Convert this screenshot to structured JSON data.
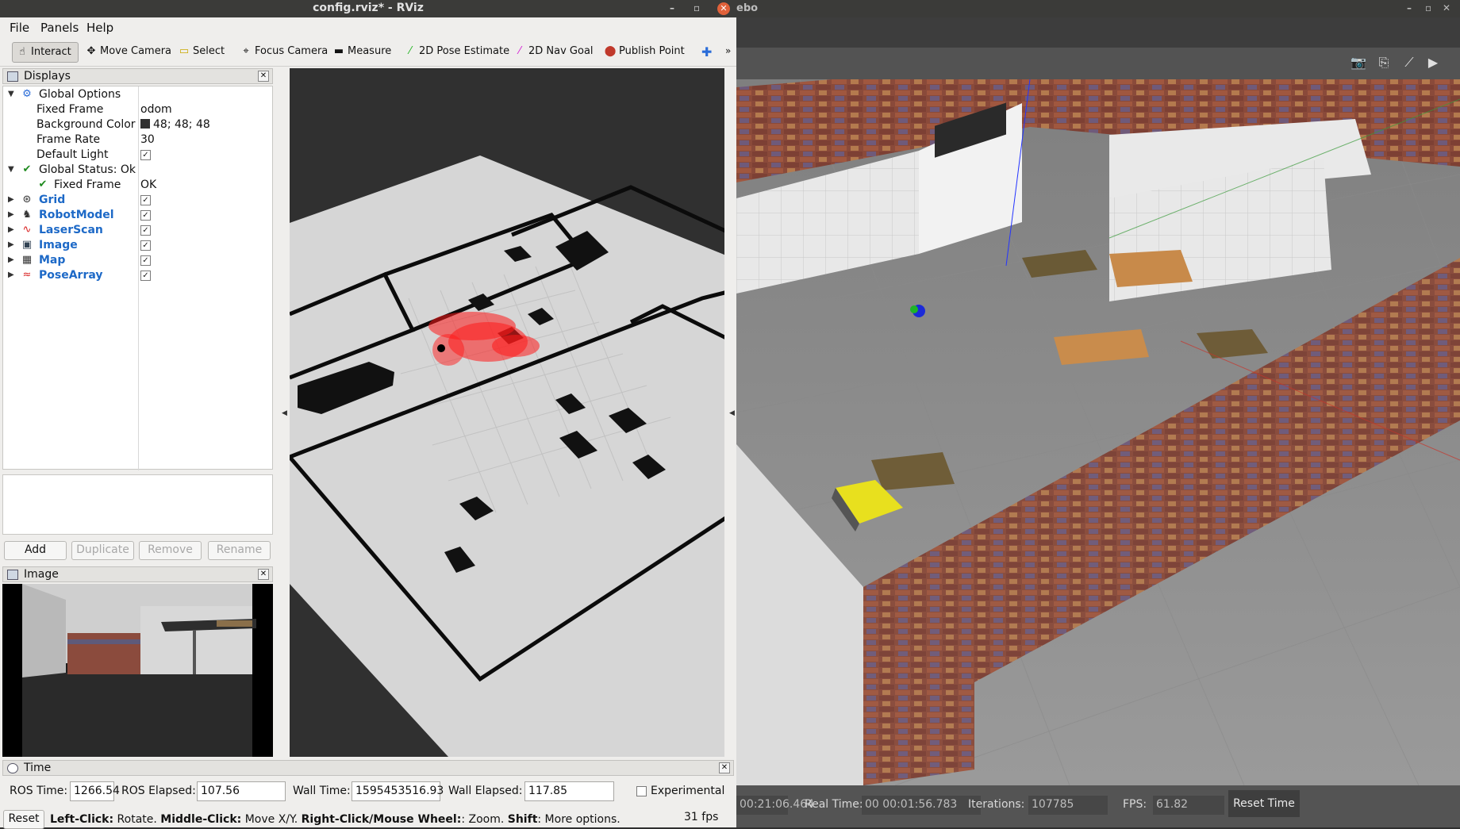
{
  "gazebo": {
    "title_fragment": "ebo",
    "bottom": {
      "sim_time": "00:21:06.464",
      "real_time_label": "Real Time:",
      "real_time": "00 00:01:56.783",
      "iterations_label": "Iterations:",
      "iterations": "107785",
      "fps_label": "FPS:",
      "fps": "61.82",
      "reset_time_label": "Reset Time"
    }
  },
  "rviz": {
    "title": "config.rviz* - RViz",
    "menu": [
      "File",
      "Panels",
      "Help"
    ],
    "toolbar": [
      {
        "label": "Interact",
        "icon": "cursor-icon"
      },
      {
        "label": "Move Camera",
        "icon": "move-camera-icon"
      },
      {
        "label": "Select",
        "icon": "select-icon"
      },
      {
        "label": "Focus Camera",
        "icon": "focus-camera-icon"
      },
      {
        "label": "Measure",
        "icon": "measure-icon"
      },
      {
        "label": "2D Pose Estimate",
        "icon": "pose-estimate-icon"
      },
      {
        "label": "2D Nav Goal",
        "icon": "nav-goal-icon"
      },
      {
        "label": "Publish Point",
        "icon": "publish-point-icon"
      }
    ],
    "displays": {
      "title": "Displays",
      "global_options": "Global Options",
      "fixed_frame_label": "Fixed Frame",
      "fixed_frame_value": "odom",
      "background_color_label": "Background Color",
      "background_color_value": "48; 48; 48",
      "frame_rate_label": "Frame Rate",
      "frame_rate_value": "30",
      "default_light_label": "Default Light",
      "global_status": "Global Status: Ok",
      "status_fixed_frame_label": "Fixed Frame",
      "status_fixed_frame_value": "OK",
      "items": [
        "Grid",
        "RobotModel",
        "LaserScan",
        "Image",
        "Map",
        "PoseArray"
      ]
    },
    "buttons": {
      "add": "Add",
      "duplicate": "Duplicate",
      "remove": "Remove",
      "rename": "Rename"
    },
    "image_panel_title": "Image",
    "time_panel": {
      "title": "Time",
      "ros_time_label": "ROS Time:",
      "ros_time": "1266.54",
      "ros_elapsed_label": "ROS Elapsed:",
      "ros_elapsed": "107.56",
      "wall_time_label": "Wall Time:",
      "wall_time": "1595453516.93",
      "wall_elapsed_label": "Wall Elapsed:",
      "wall_elapsed": "117.85",
      "experimental_label": "Experimental"
    },
    "status": {
      "reset_label": "Reset",
      "hint_parts": [
        "Left-Click:",
        " Rotate. ",
        "Middle-Click:",
        " Move X/Y. ",
        "Right-Click/Mouse Wheel:",
        ": Zoom. ",
        "Shift",
        ": More options."
      ],
      "fps": "31 fps"
    }
  },
  "colors": {
    "title_bar": "#3b3b39",
    "rviz_bg": "#efeeec",
    "link_blue": "#1d69c7",
    "rviz_view_bg": "#303030",
    "laser_red": "#ff1a1a",
    "gazebo_bottom": "#545454"
  }
}
